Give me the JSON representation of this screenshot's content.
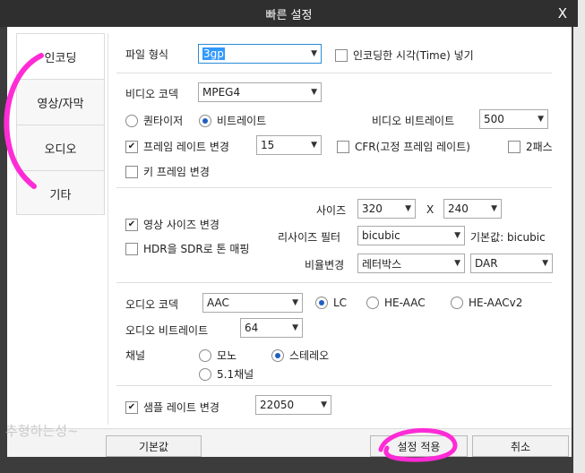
{
  "window": {
    "title": "빠른 설정",
    "close_glyph": "X"
  },
  "nav": {
    "items": [
      "인코딩",
      "영상/자막",
      "오디오",
      "기타"
    ],
    "active_index": 0
  },
  "file_format": {
    "label": "파일 형식",
    "value": "3gp",
    "insert_time_label": "인코딩한 시각(Time) 넣기",
    "insert_time_checked": false
  },
  "video": {
    "codec_label": "비디오 코덱",
    "codec_value": "MPEG4",
    "quantizer_label": "퀀타이저",
    "bitrate_mode_label": "비트레이트",
    "mode_selected": "bitrate",
    "video_bitrate_label": "비디오 비트레이트",
    "video_bitrate_value": "500",
    "framerate_change_label": "프레임 레이트 변경",
    "framerate_change_checked": true,
    "framerate_value": "15",
    "cfr_label": "CFR(고정 프레임 레이트)",
    "cfr_checked": false,
    "twopass_label": "2패스",
    "twopass_checked": false,
    "keyframe_label": "키 프레임 변경",
    "keyframe_checked": false
  },
  "resize": {
    "size_change_label": "영상 사이즈 변경",
    "size_change_checked": true,
    "hdr_label": "HDR을 SDR로 톤 매핑",
    "hdr_checked": false,
    "size_label": "사이즈",
    "width_value": "320",
    "x_sep": "X",
    "height_value": "240",
    "filter_label": "리사이즈 필터",
    "filter_value": "bicubic",
    "filter_default": "기본값: bicubic",
    "ratio_label": "비율변경",
    "ratio_value": "레터박스",
    "ratio_mode_value": "DAR"
  },
  "audio": {
    "codec_label": "오디오 코덱",
    "codec_value": "AAC",
    "profiles": [
      "LC",
      "HE-AAC",
      "HE-AACv2"
    ],
    "profile_selected": 0,
    "bitrate_label": "오디오 비트레이트",
    "bitrate_value": "64",
    "channel_label": "채널",
    "channels": [
      "모노",
      "스테레오",
      "5.1채널"
    ],
    "channel_selected": 1,
    "samplerate_change_label": "샘플 레이트 변경",
    "samplerate_change_checked": true,
    "samplerate_value": "22050"
  },
  "footer": {
    "default_button": "기본값",
    "apply_button": "설정 적용",
    "cancel_button": "취소"
  },
  "watermark": "추형하는성~",
  "colors": {
    "annotation": "#ff2bd6",
    "selection": "#3399ff",
    "titlebar": "#2f2f2f"
  }
}
